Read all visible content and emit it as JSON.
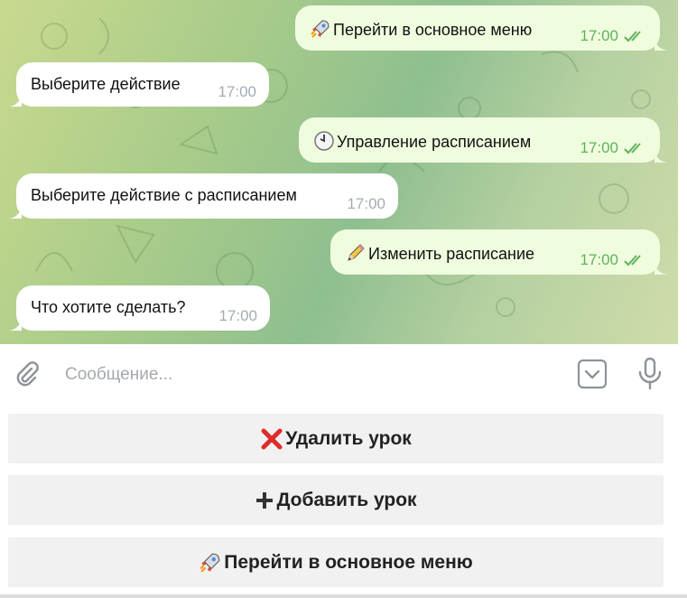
{
  "messages": [
    {
      "direction": "out",
      "emoji": "rocket-icon",
      "text": "Перейти в основное меню",
      "time": "17:00",
      "status": "read"
    },
    {
      "direction": "in",
      "text": "Выберите действие",
      "time": "17:00"
    },
    {
      "direction": "out",
      "emoji": "clock-icon",
      "text": "Управление расписанием",
      "time": "17:00",
      "status": "read"
    },
    {
      "direction": "in",
      "text": "Выберите действие с расписанием",
      "time": "17:00"
    },
    {
      "direction": "out",
      "emoji": "pencil-icon",
      "text": "Изменить расписание",
      "time": "17:00",
      "status": "read"
    },
    {
      "direction": "in",
      "text": "Что хотите сделать?",
      "time": "17:00"
    }
  ],
  "composer": {
    "placeholder": "Сообщение...",
    "value": ""
  },
  "keyboard": {
    "buttons": [
      {
        "icon": "red-cross-icon",
        "label": "Удалить урок"
      },
      {
        "icon": "plus-icon",
        "label": "Добавить урок"
      },
      {
        "icon": "rocket-icon",
        "label": "Перейти в основное меню"
      }
    ]
  },
  "colors": {
    "incoming_bubble": "#ffffff",
    "outgoing_bubble": "#effdde",
    "read_ticks": "#5fb15b",
    "keyboard_button": "#f1f1f1"
  }
}
